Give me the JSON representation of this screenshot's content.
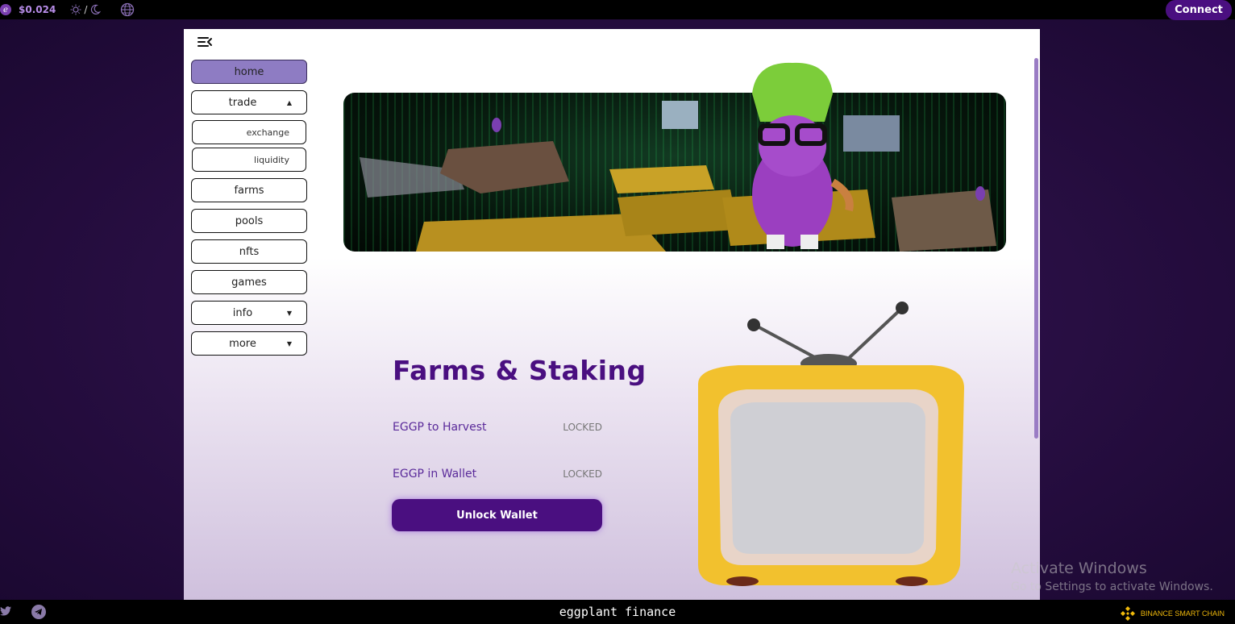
{
  "topbar": {
    "price": "$0.024",
    "theme_separator": "/",
    "connect_label": "Connect"
  },
  "nav": {
    "home": "home",
    "trade": "trade",
    "trade_sub": [
      "exchange",
      "liquidity"
    ],
    "farms": "farms",
    "pools": "pools",
    "nfts": "nfts",
    "games": "games",
    "info": "info",
    "more": "more"
  },
  "main": {
    "title": "Farms & Staking",
    "rows": [
      {
        "label": "EGGP to Harvest",
        "value": "LOCKED"
      },
      {
        "label": "EGGP in Wallet",
        "value": "LOCKED"
      }
    ],
    "unlock_label": "Unlock Wallet"
  },
  "footer": {
    "brand": "eggplant finance",
    "chain": "BINANCE SMART CHAIN"
  },
  "watermark": {
    "line1": "Activate Windows",
    "line2": "Go to Settings to activate Windows."
  },
  "colors": {
    "accent": "#4a0f80",
    "nav_active": "#8e7cc3",
    "bsc_yellow": "#f0b90b"
  }
}
